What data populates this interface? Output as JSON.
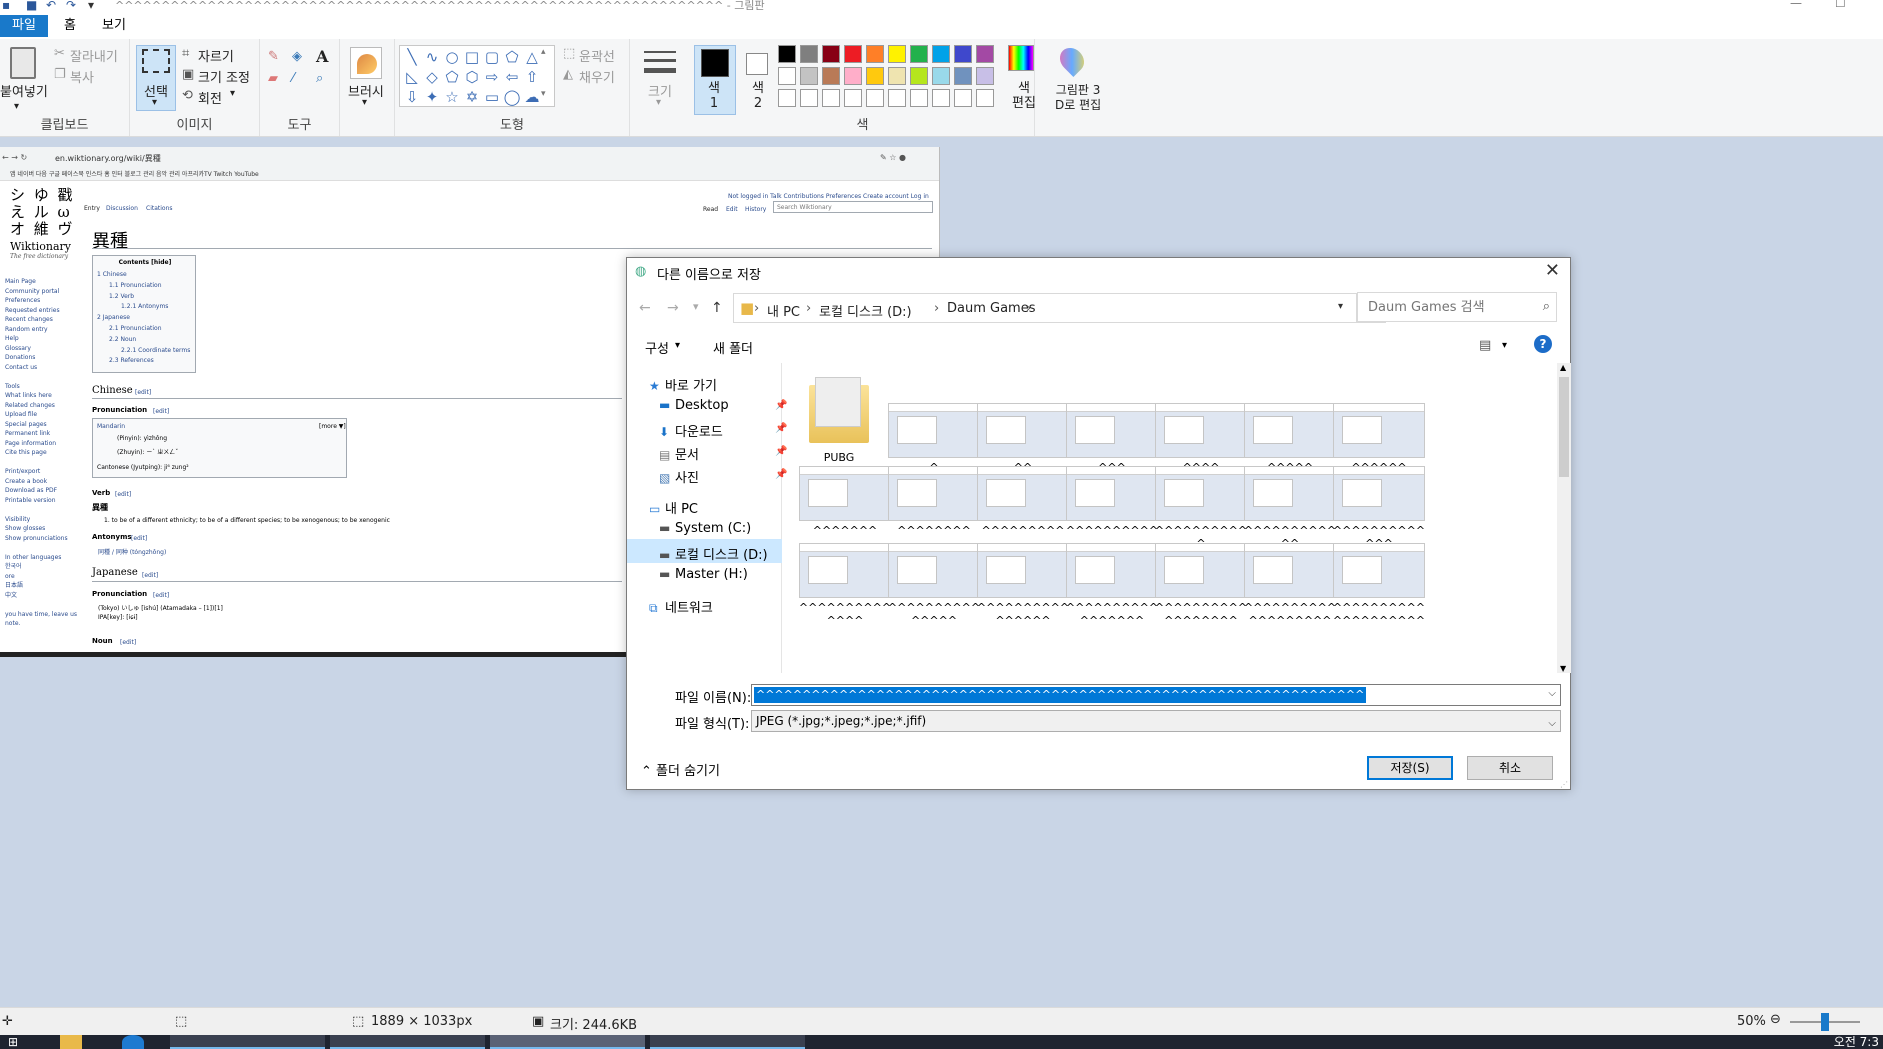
{
  "titlebar": {
    "title": "^^^^^^^^^^^^^^^^^^^^^^^^^^^^^^^^^^^^^^^^^^^^^^^^^^^^^^^^^^^^^^^^^^ - 그림판"
  },
  "menu": {
    "file": "파일",
    "home": "홈",
    "view": "보기"
  },
  "ribbon": {
    "clipboard": {
      "paste": "붙여넣기",
      "cut": "잘라내기",
      "copy": "복사",
      "label": "클립보드"
    },
    "image": {
      "select": "선택",
      "crop": "자르기",
      "resize": "크기 조정",
      "rotate": "회전",
      "label": "이미지"
    },
    "tools": {
      "text": "A",
      "label": "도구"
    },
    "brushes": {
      "label": "브러시"
    },
    "shapes": {
      "outline": "윤곽선",
      "fill": "채우기",
      "label": "도형"
    },
    "size": {
      "label": "크기"
    },
    "colors": {
      "color1": "색\n1",
      "color2": "색\n2",
      "edit_colors": "색\n편집",
      "paint3d": "그림판 3\nD로 편집",
      "label": "색",
      "palette_row1": [
        "#000000",
        "#7f7f7f",
        "#880015",
        "#ed1c24",
        "#ff7f27",
        "#fff200",
        "#22b14c",
        "#00a2e8",
        "#3f48cc",
        "#a349a4"
      ],
      "palette_row2": [
        "#ffffff",
        "#c3c3c3",
        "#b97a57",
        "#ffaec9",
        "#ffc90e",
        "#efe4b0",
        "#b5e61d",
        "#99d9ea",
        "#7092be",
        "#c8bfe7"
      ]
    }
  },
  "wiki": {
    "url": "en.wiktionary.org/wiki/異種",
    "bookmarks": "앱  네이버  다음  구글  페이스북  인스타  홈 인터  블로그 관리  음악 관리  아프리카TV  Twitch  YouTube",
    "logo_name": "Wiktionary",
    "logo_sub": "The free dictionary",
    "tabs": [
      "Entry",
      "Discussion",
      "Citations"
    ],
    "right_tabs": [
      "Read",
      "Edit",
      "History"
    ],
    "search_placeholder": "Search Wiktionary",
    "userlinks": "Not logged in  Talk  Contributions  Preferences  Create account  Log in",
    "title": "異種",
    "contents_title": "Contents [hide]",
    "toc": [
      "1 Chinese",
      "1.1 Pronunciation",
      "1.2 Verb",
      "1.2.1 Antonyms",
      "2 Japanese",
      "2.1 Pronunciation",
      "2.2 Noun",
      "2.2.1 Coordinate terms",
      "2.3 References"
    ],
    "sidebar": [
      "Main Page",
      "Community portal",
      "Preferences",
      "Requested entries",
      "Recent changes",
      "Random entry",
      "Help",
      "Glossary",
      "Donations",
      "Contact us",
      "",
      "Tools",
      "What links here",
      "Related changes",
      "Upload file",
      "Special pages",
      "Permanent link",
      "Page information",
      "Cite this page",
      "",
      "Print/export",
      "Create a book",
      "Download as PDF",
      "Printable version",
      "",
      "Visibility",
      "Show glosses",
      "Show pronunciations",
      "",
      "In other languages",
      "한국어",
      "ore",
      "日本語",
      "中文",
      "",
      "you have time, leave us",
      "note."
    ],
    "chinese": "Chinese",
    "edit": "[edit]",
    "pronunciation": "Pronunciation",
    "mandarin": "Mandarin",
    "pinyin_label": "(Pinyin): yìzhǒng",
    "zhuyin_label": "(Zhuyin): ㄧˋ ㄓㄨㄥˇ",
    "cantonese": "Cantonese (Jyutping): ji⁶ zung²",
    "more": "[more ▼]",
    "verb": "Verb",
    "headword": "異種",
    "definition": "1. to be of a different ethnicity; to be of a different species; to be xenogenous; to be xenogenic",
    "antonyms": "Antonyms",
    "antonym_item": "同種 / 同种 (tóngzhǒng)",
    "japanese": "Japanese",
    "jp_pron_1": "(Tokyo) いしゅ [ìshú] (Atamadaka – [1])[1]",
    "jp_pron_2": "IPA[key]: [iɕɨ]",
    "noun": "Noun"
  },
  "dialog": {
    "title": "다른 이름으로 저장",
    "breadcrumb": [
      "내 PC",
      "로컬 디스크 (D:)",
      "Daum Games"
    ],
    "search_placeholder": "Daum Games 검색",
    "organize": "구성",
    "new_folder": "새 폴더",
    "nav": {
      "quick": "바로 가기",
      "desktop": "Desktop",
      "downloads": "다운로드",
      "documents": "문서",
      "pictures": "사진",
      "thispc": "내 PC",
      "system_c": "System (C:)",
      "local_d": "로컬 디스크 (D:)",
      "master_h": "Master (H:)",
      "network": "네트워크"
    },
    "folder_name": "PUBG",
    "row1_labels": [
      "^",
      "^^",
      "^^^",
      "^^^^",
      "^^^^^",
      "^^^^^^"
    ],
    "row2_labels": [
      "^^^^^^^",
      "^^^^^^^^",
      "^^^^^^^^^",
      "^^^^^^^^^^",
      "^^^^^^^^^^^",
      "^^^^^^^^^^^^",
      "^^^^^^^^^^^^^"
    ],
    "row3_labels": [
      "^^^^^^^^^^^^^^",
      "^^^^^^^^^^^^^^^",
      "^^^^^^^^^^^^^^^^",
      "^^^^^^^^^^^^^^^^^",
      "^^^^^^^^^^^^^^^^^^",
      "^^^^^^^^^^^^^^^^^^^",
      "^^^^^^^^^^^^^^^^^^^^"
    ],
    "filename_label": "파일 이름(N):",
    "filename_value": "^^^^^^^^^^^^^^^^^^^^^^^^^^^^^^^^^^^^^^^^^^^^^^^^^^^^^^^^^^^^^^^^^^",
    "filetype_label": "파일 형식(T):",
    "filetype_value": "JPEG (*.jpg;*.jpeg;*.jpe;*.jfif)",
    "hide_folders": "폴더 숨기기",
    "save": "저장(S)",
    "cancel": "취소"
  },
  "status": {
    "dimensions": "1889 × 1033px",
    "size": "크기: 244.6KB",
    "zoom": "50%",
    "zoom_fraction": 0.5
  },
  "taskbar": {
    "clock": "오전 7:3"
  }
}
